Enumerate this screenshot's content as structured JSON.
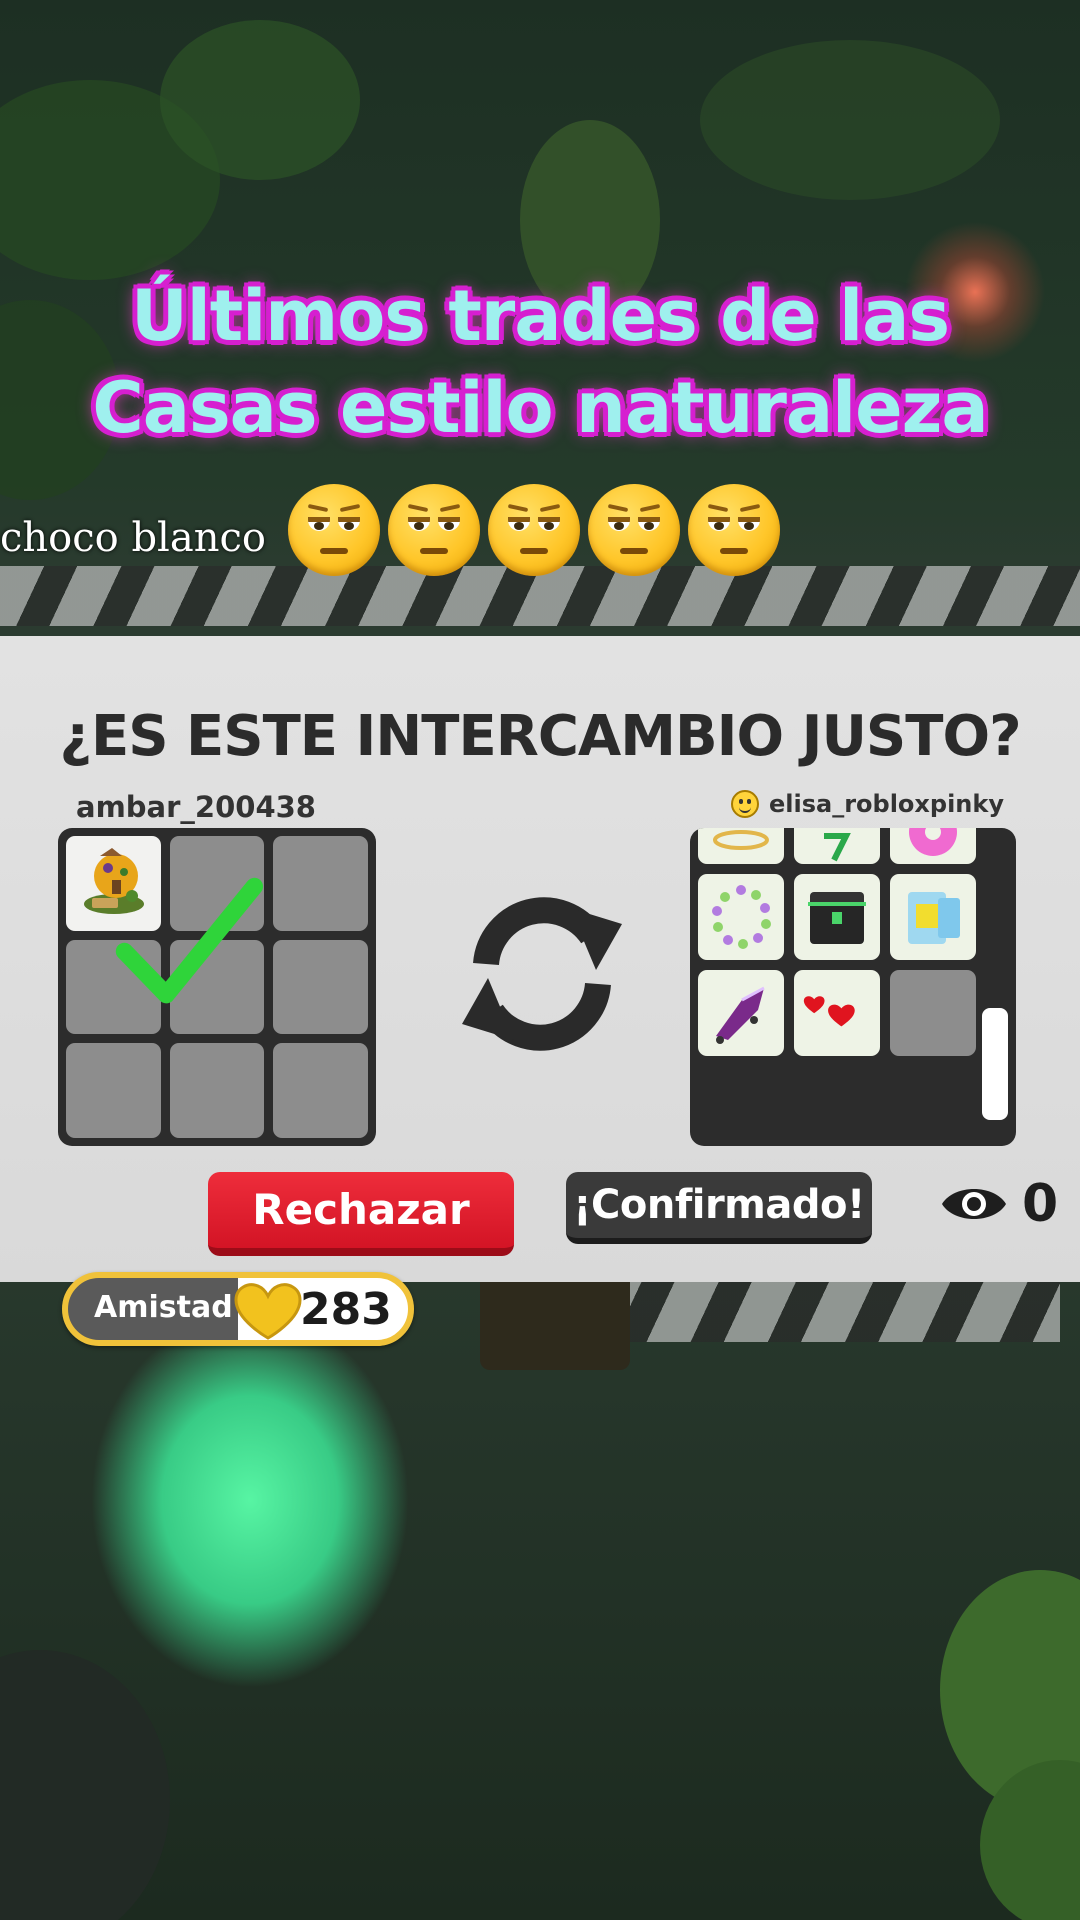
{
  "overlay": {
    "title_line1": "Últimos trades de las",
    "title_line2": "Casas estilo naturaleza",
    "caption": "choco blanco",
    "emoji_icons": [
      "pensive-face-icon",
      "pensive-face-icon",
      "pensive-face-icon",
      "pensive-face-icon",
      "pensive-face-icon"
    ]
  },
  "trade": {
    "title": "¿ES ESTE INTERCAMBIO JUSTO?",
    "left_user": "ambar_200438",
    "right_user": "elisa_robloxpinky",
    "left_items": [
      {
        "icon": "nature-house-icon"
      },
      {},
      {},
      {},
      {},
      {},
      {},
      {},
      {}
    ],
    "left_confirmed": true,
    "right_items": [
      {
        "icon": "gold-tiara-icon"
      },
      {
        "icon": "green-stick-icon"
      },
      {
        "icon": "pink-donut-icon"
      },
      {
        "icon": "bead-necklace-icon"
      },
      {
        "icon": "black-chest-icon"
      },
      {
        "icon": "sponge-drink-icon"
      },
      {
        "icon": "purple-heel-stroller-icon"
      },
      {
        "icon": "red-hearts-icon"
      },
      {}
    ],
    "reject_label": "Rechazar",
    "confirmed_label": "¡Confirmado!",
    "viewers_count": "0",
    "colors": {
      "reject": "#d31425",
      "confirmed": "#3a3a3a",
      "check": "#2fd43a"
    }
  },
  "friendship": {
    "label": "Amistad",
    "value": "283"
  }
}
